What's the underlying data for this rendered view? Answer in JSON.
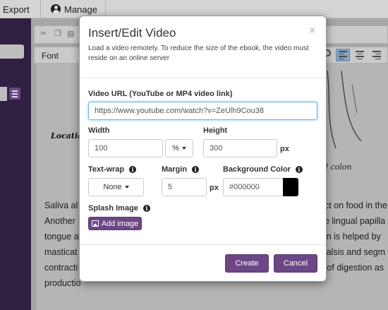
{
  "app": {
    "topbar": {
      "export_label": "Export",
      "manage_label": "Manage"
    },
    "editor": {
      "font_label": "Font",
      "figure_labels": {
        "location": "Location",
        "colon": "d colon"
      },
      "body_lines": [
        {
          "left": "Saliva al",
          "right": "ect on food in the"
        },
        {
          "left": "Another",
          "right": "ne lingual papilla"
        },
        {
          "left": "tongue a",
          "right": "ion is helped by"
        },
        {
          "left": "masticat",
          "right": "stalsis and segm"
        },
        {
          "left": "contracti",
          "right": "n of digestion as"
        },
        {
          "left": "productio",
          "right": ""
        }
      ]
    }
  },
  "modal": {
    "title": "Insert/Edit Video",
    "close_glyph": "×",
    "description": "Load a video remotely. To reduce the size of the ebook, the video must reside on an online server",
    "video_url": {
      "label": "Video URL (YouTube or MP4 video link)",
      "value": "https://www.youtube.com/watch?v=ZeUlh9Cou38"
    },
    "width": {
      "label": "Width",
      "value": "100",
      "unit_value": "%"
    },
    "height": {
      "label": "Height",
      "value": "300",
      "unit": "px"
    },
    "text_wrap": {
      "label": "Text-wrap",
      "value": "None"
    },
    "margin": {
      "label": "Margin",
      "value": "5",
      "unit": "px"
    },
    "background_color": {
      "label": "Background Color",
      "value": "#000000",
      "swatch": "#000000"
    },
    "splash_image": {
      "label": "Splash Image",
      "button": "Add image"
    },
    "buttons": {
      "create": "Create",
      "cancel": "Cancel"
    },
    "info_glyph": "i"
  },
  "colors": {
    "accent_purple": "#6d4686",
    "sidebar": "#36254a",
    "focus_blue": "#66afe9"
  }
}
